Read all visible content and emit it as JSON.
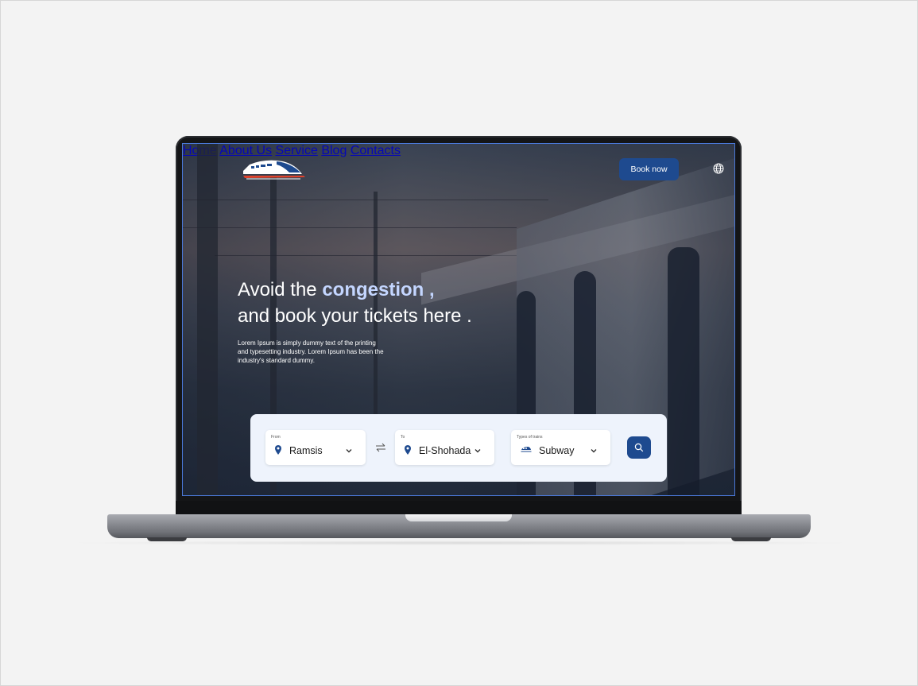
{
  "nav": {
    "items": [
      {
        "label": "Home"
      },
      {
        "label": "About Us"
      },
      {
        "label": "Service"
      },
      {
        "label": "Blog"
      },
      {
        "label": "Contacts"
      }
    ],
    "book_label": "Book now",
    "globe_icon": "globe-icon",
    "logo_icon": "train-logo-icon"
  },
  "hero": {
    "line1_prefix": "Avoid the ",
    "line1_highlight": "congestion ,",
    "line2": "and book your tickets here .",
    "description": "Lorem Ipsum is simply dummy text of the printing and typesetting industry. Lorem Ipsum has been the industry's standard dummy."
  },
  "search": {
    "from": {
      "label": "From",
      "value": "Ramsis",
      "icon": "location-pin-icon"
    },
    "to": {
      "label": "To",
      "value": "El-Shohada",
      "icon": "location-pin-icon"
    },
    "train_type": {
      "label": "Types of trains",
      "value": "Subway",
      "icon": "train-icon"
    },
    "swap_icon": "swap-arrows-icon",
    "search_icon": "search-icon"
  },
  "colors": {
    "primary": "#1e4a8f",
    "highlight": "#c4d6ff",
    "panel_bg": "#eef3fc",
    "accent_red": "#e0432c"
  }
}
